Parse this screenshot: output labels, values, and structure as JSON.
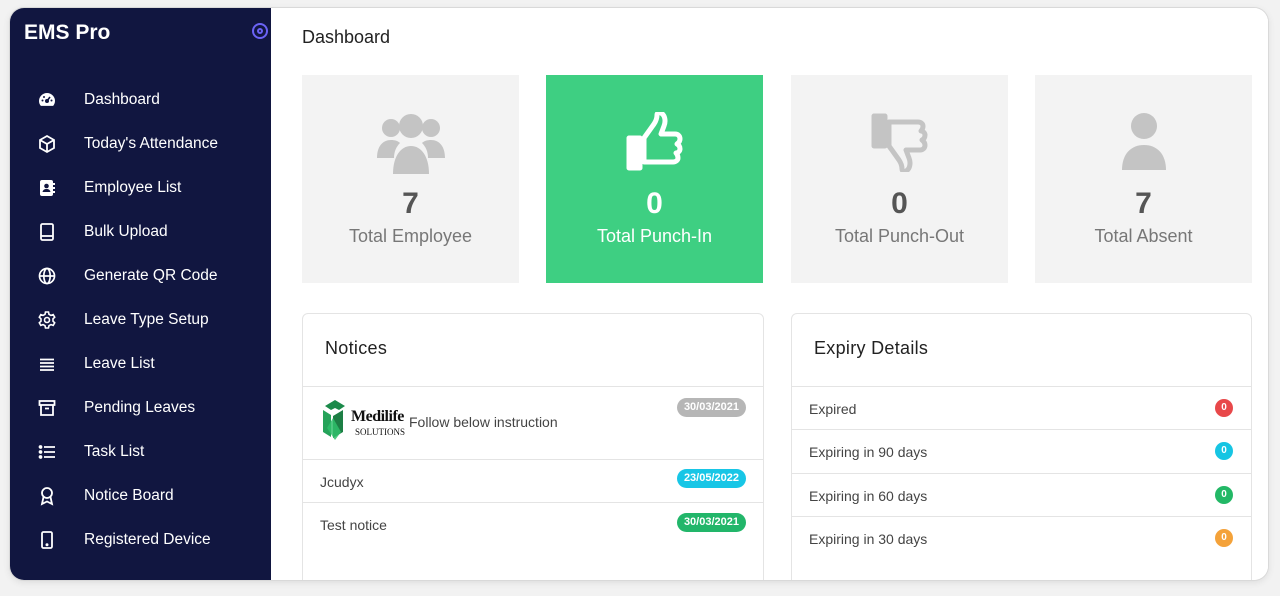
{
  "app": {
    "brand": "EMS Pro"
  },
  "sidebar": {
    "items": [
      {
        "label": "Dashboard",
        "icon": "dashboard-icon"
      },
      {
        "label": "Today's Attendance",
        "icon": "cube-icon"
      },
      {
        "label": "Employee List",
        "icon": "contact-book-icon"
      },
      {
        "label": "Bulk Upload",
        "icon": "tablet-icon"
      },
      {
        "label": "Generate QR Code",
        "icon": "globe-icon"
      },
      {
        "label": "Leave Type Setup",
        "icon": "gear-icon"
      },
      {
        "label": "Leave List",
        "icon": "list-lines-icon"
      },
      {
        "label": "Pending Leaves",
        "icon": "archive-icon"
      },
      {
        "label": "Task List",
        "icon": "task-list-icon"
      },
      {
        "label": "Notice Board",
        "icon": "award-icon"
      },
      {
        "label": "Registered Device",
        "icon": "mobile-device-icon"
      }
    ]
  },
  "header": {
    "title": "Dashboard"
  },
  "stats": [
    {
      "value": "7",
      "label": "Total Employee",
      "icon": "users-icon"
    },
    {
      "value": "0",
      "label": "Total Punch-In",
      "icon": "thumbs-up-icon"
    },
    {
      "value": "0",
      "label": "Total Punch-Out",
      "icon": "thumbs-down-icon"
    },
    {
      "value": "7",
      "label": "Total Absent",
      "icon": "user-icon"
    }
  ],
  "notices": {
    "title": "Notices",
    "items": [
      {
        "text": "Follow below instruction",
        "date": "30/03/2021",
        "color": "#b6b6b6",
        "logo_text": "Medilife",
        "logo_sub": "SOLUTIONS"
      },
      {
        "text": "Jcudyx",
        "date": "23/05/2022",
        "color": "#18c6e6"
      },
      {
        "text": "Test notice",
        "date": "30/03/2021",
        "color": "#22b66a"
      }
    ]
  },
  "expiry": {
    "title": "Expiry Details",
    "items": [
      {
        "label": "Expired",
        "count": "0",
        "color": "#e8484a"
      },
      {
        "label": "Expiring in 90 days",
        "count": "0",
        "color": "#16c5e3"
      },
      {
        "label": "Expiring in 60 days",
        "count": "0",
        "color": "#23b866"
      },
      {
        "label": "Expiring in 30 days",
        "count": "0",
        "color": "#f4a23a"
      }
    ]
  },
  "colors": {
    "sidebar_bg": "#111640",
    "accent_green": "#3ecf82"
  }
}
